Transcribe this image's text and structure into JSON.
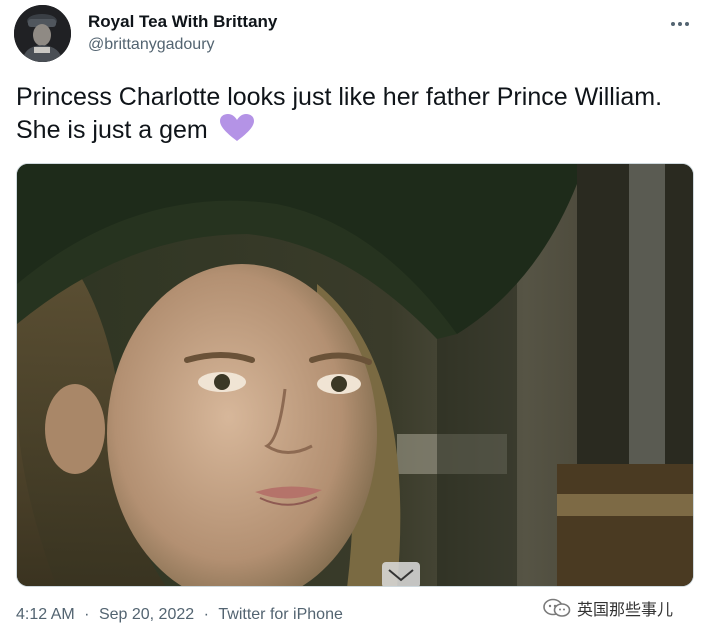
{
  "tweet": {
    "author_name": "Royal Tea With Brittany",
    "author_handle": "@brittanygadoury",
    "text": "Princess Charlotte looks just like her father Prince William. She is just a gem",
    "emoji": "purple-heart",
    "time": "4:12 AM",
    "date": "Sep 20, 2022",
    "separator": "·",
    "source": "Twitter for iPhone"
  },
  "watermark": {
    "text": "英国那些事儿"
  },
  "colors": {
    "text_primary": "#0f1419",
    "text_secondary": "#536471",
    "heart": "#b493e6",
    "border": "#cfd9de"
  },
  "icons": [
    "more-options-icon",
    "purple-heart-emoji",
    "watermark-logo-icon"
  ]
}
